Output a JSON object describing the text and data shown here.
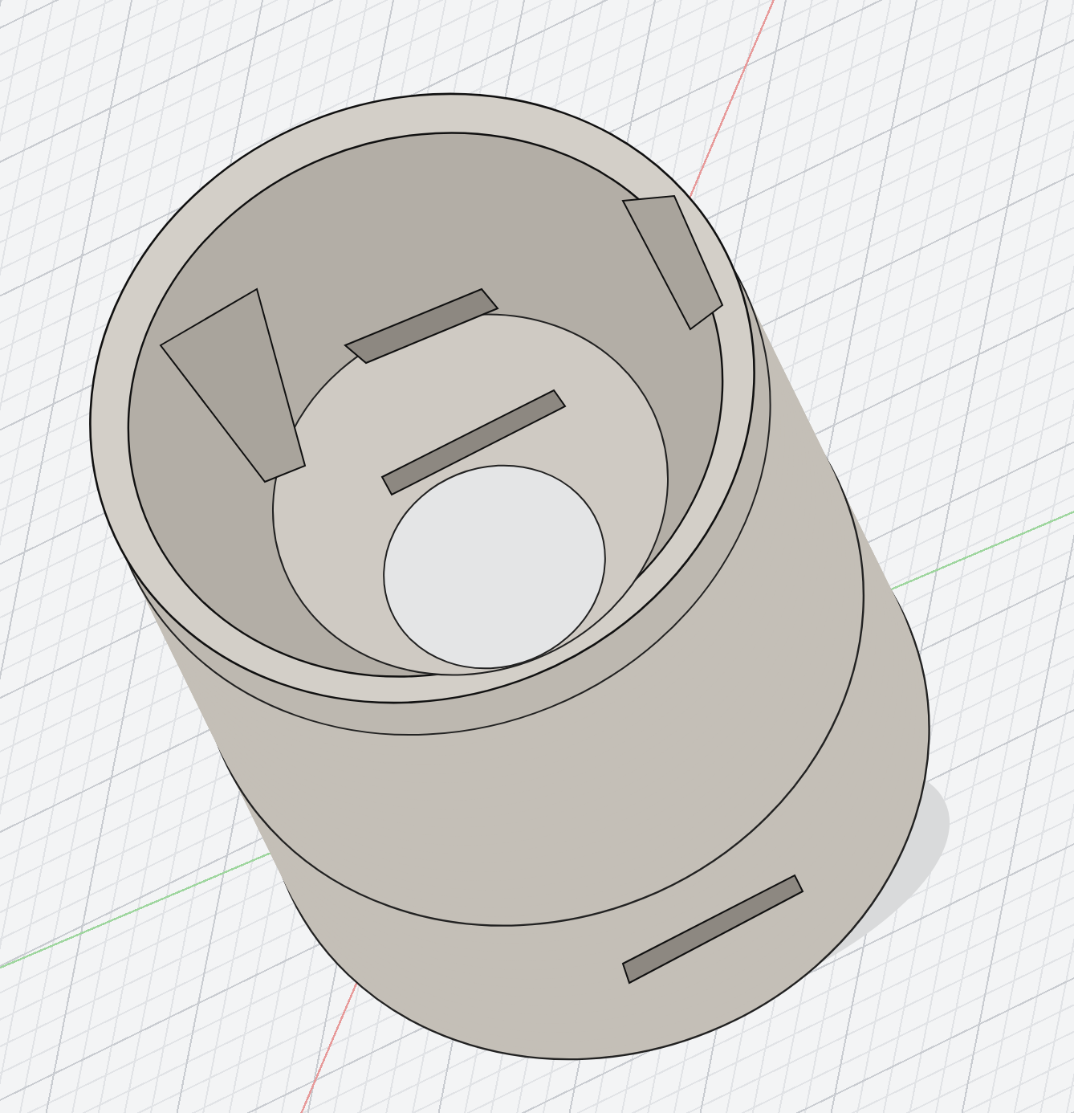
{
  "viewport": {
    "grid": true
  }
}
